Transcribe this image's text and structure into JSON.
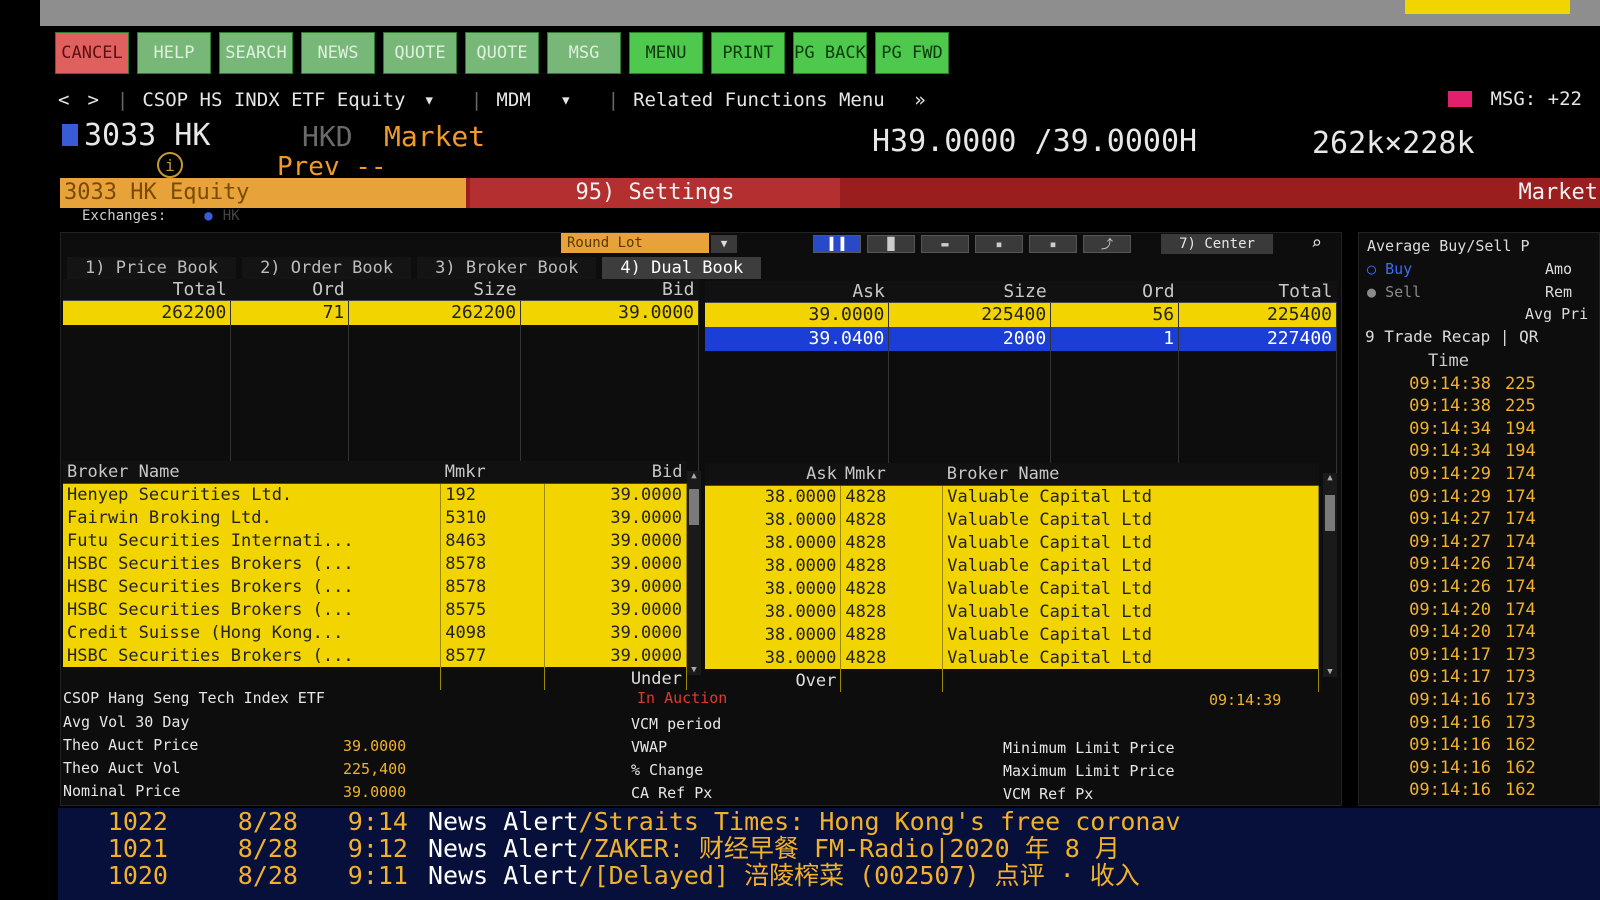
{
  "toolbar": {
    "buttons": [
      "CANCEL",
      "HELP",
      "SEARCH",
      "NEWS",
      "QUOTE",
      "QUOTE",
      "MSG",
      "MENU",
      "PRINT",
      "PG BACK",
      "PG FWD"
    ]
  },
  "nav": {
    "back": "<",
    "forward": ">",
    "security": "CSOP HS INDX ETF Equity",
    "security_chevron": "▾",
    "function": "MDM",
    "function_chevron": "▾",
    "related": "Related Functions Menu",
    "related_chevron": "»",
    "msg": "MSG: +22"
  },
  "header": {
    "ticker": "3033 HK",
    "currency": "HKD",
    "market_label": "Market",
    "prev_label": "Prev --",
    "quote": "H39.0000 /39.0000H",
    "sizes": "262k×228k"
  },
  "bar": {
    "equity": "3033 HK Equity",
    "settings": "95) Settings",
    "market": "Market"
  },
  "exchanges": {
    "label": "Exchanges:",
    "code": "HK"
  },
  "controls": {
    "round_lot": "Round Lot",
    "center": "7) Center"
  },
  "tabs": [
    "1) Price Book",
    "2) Order Book",
    "3) Broker Book",
    "4) Dual Book"
  ],
  "book": {
    "bid_headers": [
      "Total",
      "Ord",
      "Size",
      "Bid"
    ],
    "ask_headers": [
      "Ask",
      "Size",
      "Ord",
      "Total"
    ],
    "bids": [
      [
        "262200",
        "71",
        "262200",
        "39.0000"
      ]
    ],
    "asks": [
      [
        "39.0000",
        "225400",
        "56",
        "225400"
      ],
      [
        "39.0400",
        "2000",
        "1",
        "227400"
      ]
    ]
  },
  "brokers": {
    "bid_headers": [
      "Broker Name",
      "Mmkr",
      "Bid"
    ],
    "ask_headers": [
      "Ask",
      "Mmkr",
      "Broker Name"
    ],
    "bid_rows": [
      [
        "Henyep Securities Ltd.",
        "192",
        "39.0000"
      ],
      [
        "Fairwin Broking Ltd.",
        "5310",
        "39.0000"
      ],
      [
        "Futu Securities Internati...",
        "8463",
        "39.0000"
      ],
      [
        "HSBC Securities Brokers (...",
        "8578",
        "39.0000"
      ],
      [
        "HSBC Securities Brokers (...",
        "8578",
        "39.0000"
      ],
      [
        "HSBC Securities Brokers (...",
        "8575",
        "39.0000"
      ],
      [
        "Credit Suisse (Hong Kong...",
        "4098",
        "39.0000"
      ],
      [
        "HSBC Securities Brokers (...",
        "8577",
        "39.0000"
      ]
    ],
    "ask_rows": [
      [
        "38.0000",
        "4828",
        "Valuable Capital Ltd"
      ],
      [
        "38.0000",
        "4828",
        "Valuable Capital Ltd"
      ],
      [
        "38.0000",
        "4828",
        "Valuable Capital Ltd"
      ],
      [
        "38.0000",
        "4828",
        "Valuable Capital Ltd"
      ],
      [
        "38.0000",
        "4828",
        "Valuable Capital Ltd"
      ],
      [
        "38.0000",
        "4828",
        "Valuable Capital Ltd"
      ],
      [
        "38.0000",
        "4828",
        "Valuable Capital Ltd"
      ],
      [
        "38.0000",
        "4828",
        "Valuable Capital Ltd"
      ]
    ],
    "under": "Under",
    "over": "Over"
  },
  "info": {
    "name": "CSOP Hang Seng Tech Index ETF",
    "status": "In Auction",
    "time": "09:14:39",
    "avg_vol_label": "Avg Vol 30 Day",
    "theo_price_label": "Theo Auct Price",
    "theo_price": "39.0000",
    "theo_vol_label": "Theo Auct Vol",
    "theo_vol": "225,400",
    "nominal_label": "Nominal Price",
    "nominal": "39.0000",
    "vcm_period": "VCM period",
    "vwap": "VWAP",
    "pct_change": "% Change",
    "ca_ref": "CA Ref Px",
    "min_limit": "Minimum Limit Price",
    "max_limit": "Maximum Limit Price",
    "vcm_ref": "VCM Ref Px"
  },
  "side": {
    "title": "Average Buy/Sell P",
    "buy": "Buy",
    "sell": "Sell",
    "amount": "Amo",
    "remaining": "Rem",
    "avg_price": "Avg Pri",
    "trade_recap": "9 Trade Recap | QR",
    "time_header": "Time",
    "trades": [
      [
        "09:14:38",
        "225"
      ],
      [
        "09:14:38",
        "225"
      ],
      [
        "09:14:34",
        "194"
      ],
      [
        "09:14:34",
        "194"
      ],
      [
        "09:14:29",
        "174"
      ],
      [
        "09:14:29",
        "174"
      ],
      [
        "09:14:27",
        "174"
      ],
      [
        "09:14:27",
        "174"
      ],
      [
        "09:14:26",
        "174"
      ],
      [
        "09:14:26",
        "174"
      ],
      [
        "09:14:20",
        "174"
      ],
      [
        "09:14:20",
        "174"
      ],
      [
        "09:14:17",
        "173"
      ],
      [
        "09:14:17",
        "173"
      ],
      [
        "09:14:16",
        "173"
      ],
      [
        "09:14:16",
        "173"
      ],
      [
        "09:14:16",
        "162"
      ],
      [
        "09:14:16",
        "162"
      ],
      [
        "09:14:16",
        "162"
      ]
    ]
  },
  "news": [
    {
      "num": "1022",
      "date": "8/28",
      "time": "9:14",
      "kind": "News Alert",
      "text": "/Straits Times: Hong Kong's free coronav"
    },
    {
      "num": "1021",
      "date": "8/28",
      "time": "9:12",
      "kind": "News Alert",
      "text": "/ZAKER: 财经早餐 FM-Radio|2020 年 8 月"
    },
    {
      "num": "1020",
      "date": "8/28",
      "time": "9:11",
      "kind": "News Alert",
      "text": "/[Delayed] 涪陵榨菜 (002507) 点评 · 收入"
    }
  ],
  "colors": {
    "green_button": "#4ec94e",
    "cancel_button": "#e06060",
    "amber": "#f1b12a",
    "yellow": "#f1d400",
    "blue_row": "#1b3fd6",
    "red_bar": "#9a1e1e",
    "news_bg": "#07103a"
  }
}
